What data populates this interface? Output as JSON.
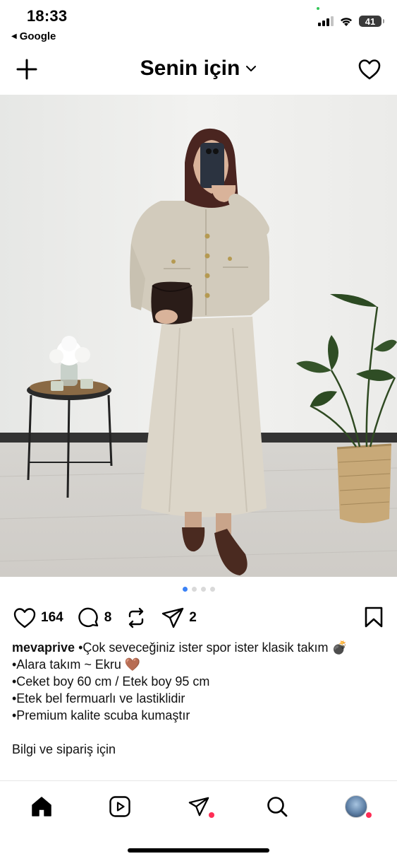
{
  "status_bar": {
    "time": "18:33",
    "back_label": "Google",
    "battery": "41"
  },
  "header": {
    "title": "Senin için"
  },
  "post": {
    "carousel": {
      "count": 4,
      "active_index": 0
    },
    "likes": "164",
    "comments": "8",
    "shares": "2",
    "username": "mevaprive",
    "caption_lines": [
      "•Çok seveceğiniz ister spor ister klasik takım 💣",
      "•Alara takım ~ Ekru 🤎",
      "•Ceket boy 60 cm / Etek boy 95 cm",
      "•Etek bel fermuarlı ve lastiklidir",
      "•Premium kalite scuba kumaştır",
      "",
      "Bilgi ve sipariş için"
    ]
  },
  "icons": {
    "plus": "plus-icon",
    "heart": "heart-icon",
    "comment": "comment-icon",
    "repost": "repost-icon",
    "send": "send-icon",
    "bookmark": "bookmark-icon",
    "home": "home-icon",
    "reels": "reels-icon",
    "search": "search-icon"
  },
  "colors": {
    "active_dot": "#3b82f6",
    "notification_dot": "#ff2d55"
  }
}
